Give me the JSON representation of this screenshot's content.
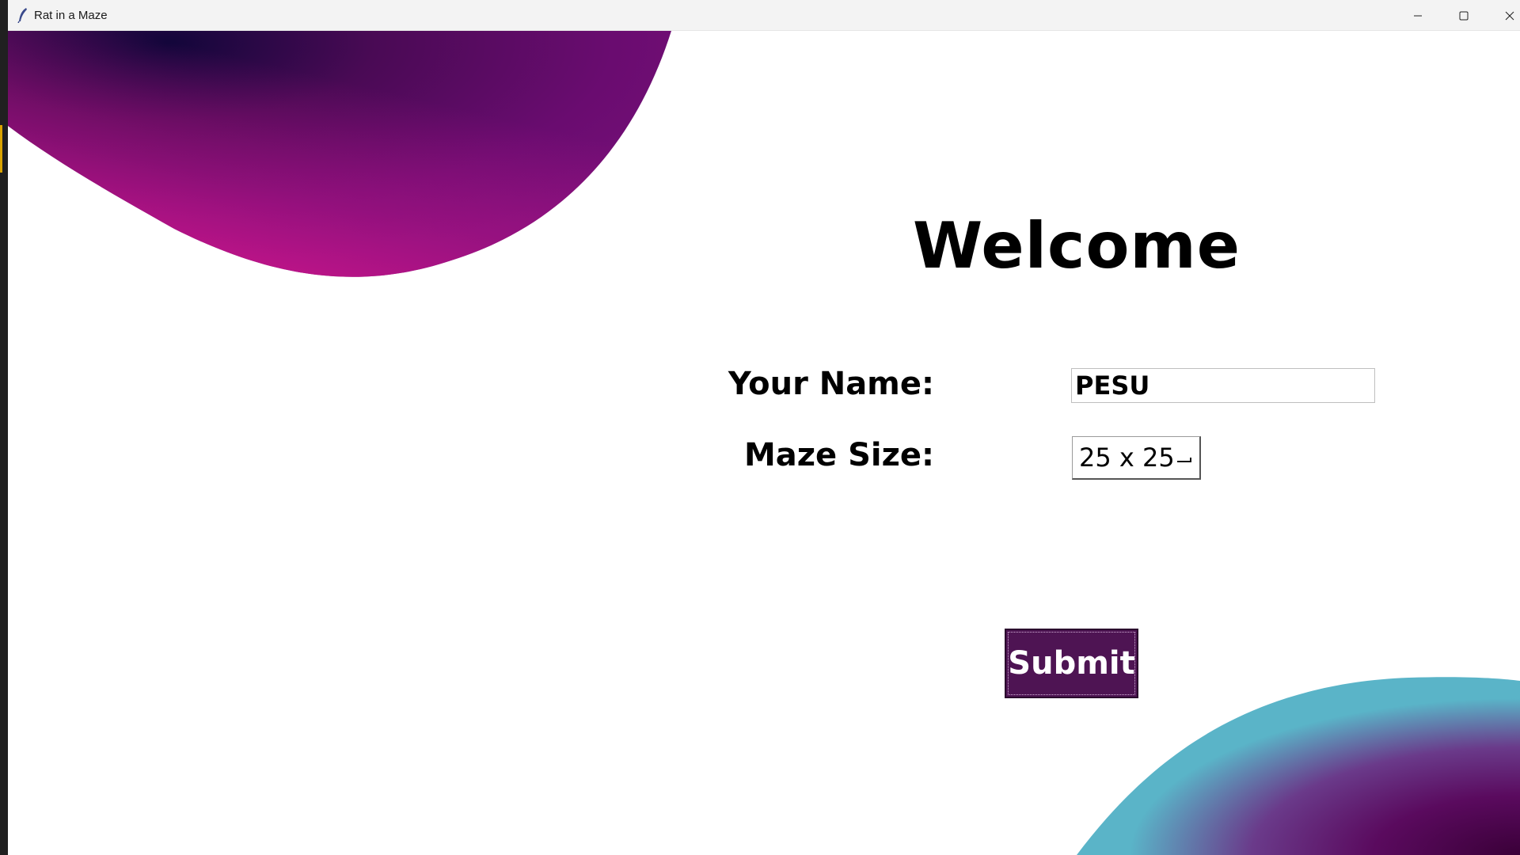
{
  "window": {
    "title": "Rat in a Maze"
  },
  "icons": {
    "app": "feather-icon",
    "minimize": "minimize-icon",
    "maximize": "maximize-icon",
    "close": "close-icon",
    "dropdown": "option-menu-indicator-icon"
  },
  "colors": {
    "accent_purple": "#4e1453",
    "blob_pink": "#d4178a",
    "blob_dark": "#12063a",
    "blob_teal": "#5ab4c8"
  },
  "form": {
    "heading": "Welcome",
    "name_label": "Your Name:",
    "name_value": "PESU",
    "size_label": "Maze Size:",
    "size_value": "25 x 25",
    "submit_label": "Submit"
  }
}
